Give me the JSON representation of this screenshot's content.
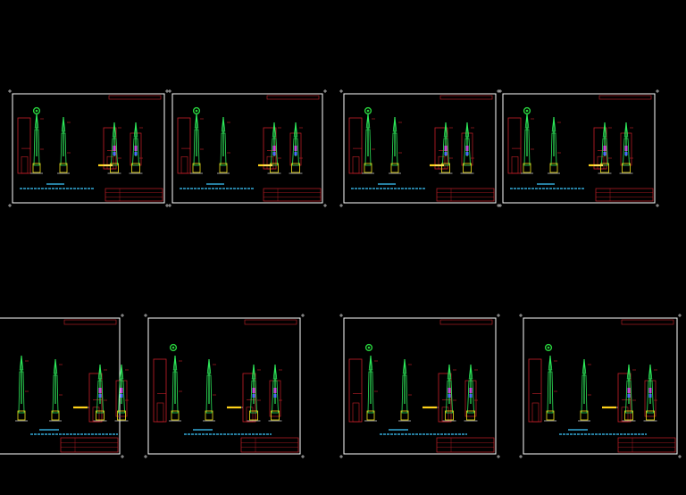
{
  "colors": {
    "background": "#000000",
    "frame": "#ffffff",
    "outline": "#c8202a",
    "pole": "#2ee85a",
    "pole_shade": "#1f8f3a",
    "accent_blue": "#4a6cff",
    "accent_magenta": "#c04ad8",
    "accent_yellow": "#f2e21a",
    "caption": "#3ec9ff",
    "label": "#ffd21a",
    "title_block": "#c8202a",
    "marker": "#28d13c"
  },
  "sheets": [
    {
      "id": "row1-sheet1",
      "has_marker": true,
      "tall_left": true,
      "poles": 2,
      "right_poles": 2,
      "has_label": true
    },
    {
      "id": "row1-sheet2",
      "has_marker": true,
      "tall_left": true,
      "poles": 2,
      "right_poles": 2,
      "has_label": true
    },
    {
      "id": "row1-sheet3",
      "has_marker": true,
      "tall_left": true,
      "poles": 2,
      "right_poles": 2,
      "has_label": true
    },
    {
      "id": "row1-sheet4",
      "has_marker": true,
      "tall_left": true,
      "poles": 2,
      "right_poles": 2,
      "has_label": true
    },
    {
      "id": "row2-sheet1",
      "has_marker": false,
      "tall_left": false,
      "poles": 2,
      "right_poles": 2,
      "has_label": true
    },
    {
      "id": "row2-sheet2",
      "has_marker": true,
      "tall_left": true,
      "poles": 2,
      "right_poles": 2,
      "has_label": true
    },
    {
      "id": "row2-sheet3",
      "has_marker": true,
      "tall_left": true,
      "poles": 2,
      "right_poles": 2,
      "has_label": true
    },
    {
      "id": "row2-sheet4",
      "has_marker": true,
      "tall_left": true,
      "poles": 2,
      "right_poles": 2,
      "has_label": true
    }
  ]
}
